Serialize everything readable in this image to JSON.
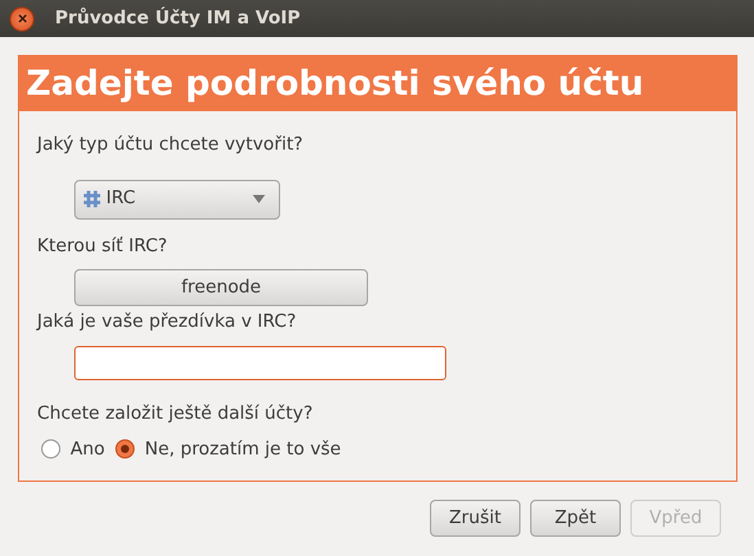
{
  "window": {
    "title": "Průvodce Účty IM a VoIP"
  },
  "header": "Zadejte podrobnosti svého účtu",
  "account_type": {
    "label": "Jaký typ účtu chcete vytvořit?",
    "value": "IRC"
  },
  "network": {
    "label": "Kterou síť IRC?",
    "button": "freenode"
  },
  "nickname": {
    "label": "Jaká je vaše přezdívka v IRC?",
    "focused": true
  },
  "more_accounts": {
    "label": "Chcete založit ještě další účty?",
    "options": [
      {
        "label": "Ano",
        "selected": false
      },
      {
        "label": "Ne, prozatím je to vše",
        "selected": true
      }
    ]
  },
  "buttons": [
    {
      "label": "Zrušit",
      "disabled": false
    },
    {
      "label": "Zpět",
      "disabled": false
    },
    {
      "label": "Vpřed",
      "disabled": true
    }
  ]
}
